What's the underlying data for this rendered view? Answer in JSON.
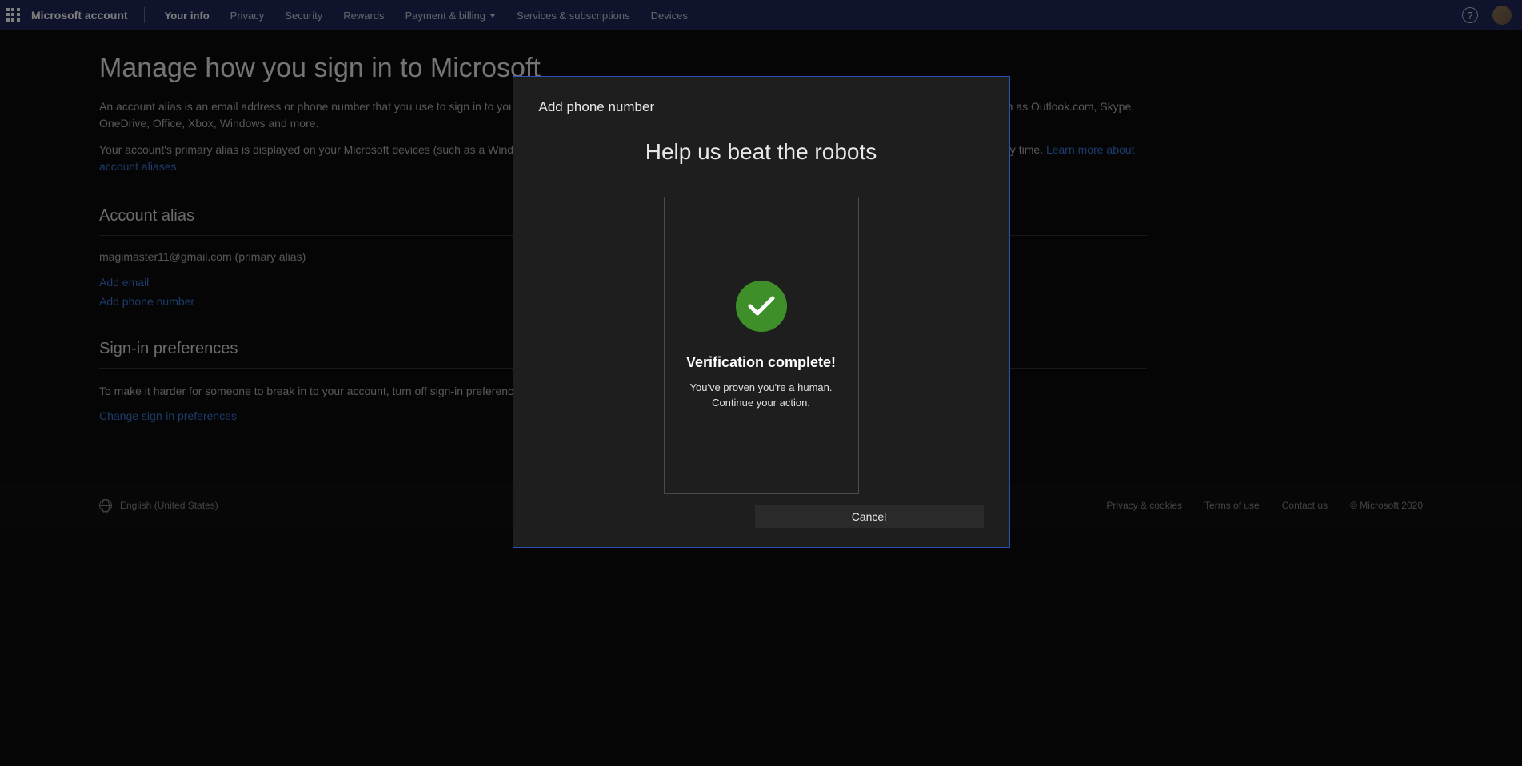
{
  "header": {
    "brand": "Microsoft account",
    "nav": {
      "yourInfo": "Your info",
      "privacy": "Privacy",
      "security": "Security",
      "rewards": "Rewards",
      "paymentBilling": "Payment & billing",
      "servicesSubscriptions": "Services & subscriptions",
      "devices": "Devices"
    }
  },
  "page": {
    "title": "Manage how you sign in to Microsoft",
    "description1": "An account alias is an email address or phone number that you use to sign in to your Microsoft account. You can have multiple aliases, and use any of them with Microsoft services such as Outlook.com, Skype, OneDrive, Office, Xbox, Windows and more.",
    "description2": "Your account's primary alias is displayed on your Microsoft devices (such as a Windows PC, Xbox, or Windows Phone), and you can choose a different alias to be the primary one at any time. ",
    "learnMore": "Learn more about account aliases.",
    "accountAliasTitle": "Account alias",
    "aliasEmail": "magimaster11@gmail.com (primary alias)",
    "addEmail": "Add email",
    "addPhone": "Add phone number",
    "signInPrefsTitle": "Sign-in preferences",
    "signInPrefsDesc": "To make it harder for someone to break in to your account, turn off sign-in preferences for any email address, phone number, or Skype name you don't use.",
    "changePrefs": "Change sign-in preferences"
  },
  "footer": {
    "language": "English (United States)",
    "privacyCookies": "Privacy & cookies",
    "termsOfUse": "Terms of use",
    "contactUs": "Contact us",
    "copyright": "© Microsoft 2020"
  },
  "modal": {
    "title": "Add phone number",
    "captchaTitle": "Help us beat the robots",
    "verificationTitle": "Verification complete!",
    "verificationLine1": "You've proven you're a human.",
    "verificationLine2": "Continue your action.",
    "cancel": "Cancel"
  }
}
